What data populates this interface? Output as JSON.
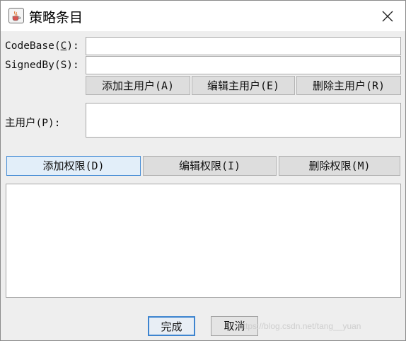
{
  "window": {
    "title": "策略条目",
    "icon": "java-cup-icon",
    "close_icon": "close-icon"
  },
  "form": {
    "codebase_label_pre": "CodeBase(",
    "codebase_label_mnemonic": "C",
    "codebase_label_post": "):",
    "codebase_value": "",
    "signedby_label": "SignedBy(S):",
    "signedby_value": "",
    "principal_label": "主用户(P):",
    "principal_value": ""
  },
  "principal_buttons": {
    "add": "添加主用户(A)",
    "edit": "编辑主用户(E)",
    "remove": "删除主用户(R)"
  },
  "permission_buttons": {
    "add": "添加权限(D)",
    "edit": "编辑权限(I)",
    "remove": "删除权限(M)"
  },
  "permissions_list": [],
  "dialog_buttons": {
    "done": "完成",
    "cancel": "取消"
  },
  "watermark": "https://blog.csdn.net/tang__yuan",
  "colors": {
    "window_bg": "#eeeeee",
    "focus_border": "#4a8fd6",
    "focus_fill": "#e2eef9"
  }
}
